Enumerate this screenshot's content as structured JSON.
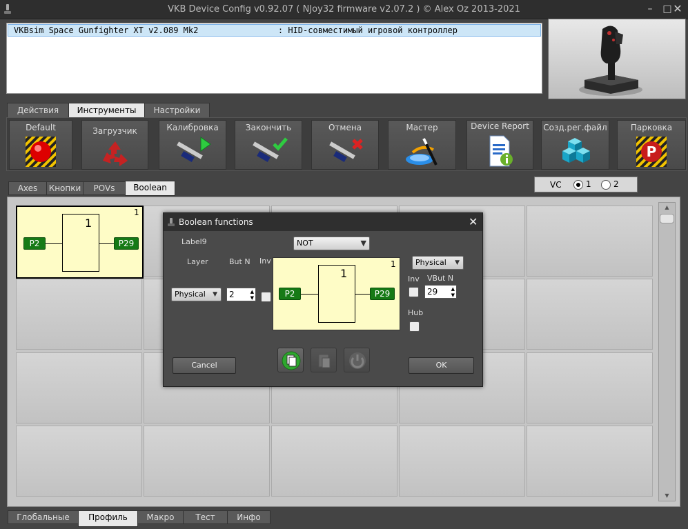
{
  "window": {
    "title": "VKB Device Config v0.92.07 ( NJoy32 firmware v2.07.2 ) © Alex Oz 2013-2021",
    "minimize": "–",
    "maximize": "□",
    "close": "✕"
  },
  "device_list": {
    "rows": [
      "VKBsim Space Gunfighter XT v2.089 Mk2                : HID-совместимый игровой контроллер"
    ]
  },
  "main_tabs": [
    "Действия",
    "Инструменты",
    "Настройки"
  ],
  "toolbar": {
    "buttons": [
      {
        "label": "Default",
        "icon": "red-button-icon"
      },
      {
        "label": "Загрузчик",
        "icon": "recycle-icon"
      },
      {
        "label": "Калибровка",
        "icon": "calipers-play-icon"
      },
      {
        "label": "Закончить",
        "icon": "calipers-check-icon"
      },
      {
        "label": "Отмена",
        "icon": "calipers-cancel-icon"
      },
      {
        "label": "Мастер",
        "icon": "wizard-wand-icon"
      },
      {
        "label": "Device Report",
        "icon": "report-info-icon"
      },
      {
        "label": "Созд.рег.файл",
        "icon": "registry-cubes-icon"
      },
      {
        "label": "Парковка",
        "icon": "parking-icon"
      }
    ]
  },
  "sub_tabs": [
    "Axes",
    "Кнопки",
    "POVs",
    "Boolean"
  ],
  "vc": {
    "label": "VC",
    "options": [
      "1",
      "2"
    ],
    "selected": "1"
  },
  "grid_cell": {
    "number": "1",
    "gate_value": "1",
    "input_pin": "P2",
    "output_pin": "P29"
  },
  "bottom_tabs": [
    "Глобальные",
    "Профиль",
    "Макро",
    "Тест",
    "Инфо"
  ],
  "dialog": {
    "title": "Boolean functions",
    "close": "✕",
    "label9": "Label9",
    "function_select": "NOT",
    "layer_label": "Layer",
    "butn_label": "But N",
    "inv_label": "Inv",
    "layer_select": "Physical",
    "butn_value": "2",
    "output_layer_select": "Physical",
    "out_inv_label": "Inv",
    "vbutn_label": "VBut N",
    "vbutn_value": "29",
    "hub_label": "Hub",
    "preview": {
      "number": "1",
      "gate_value": "1",
      "input_pin": "P2",
      "output_pin": "P29"
    },
    "cancel": "Cancel",
    "ok": "OK"
  },
  "colors": {
    "pin_green": "#167a16",
    "gate_yellow": "#fefcc6",
    "selection_blue": "#cde6f7"
  }
}
